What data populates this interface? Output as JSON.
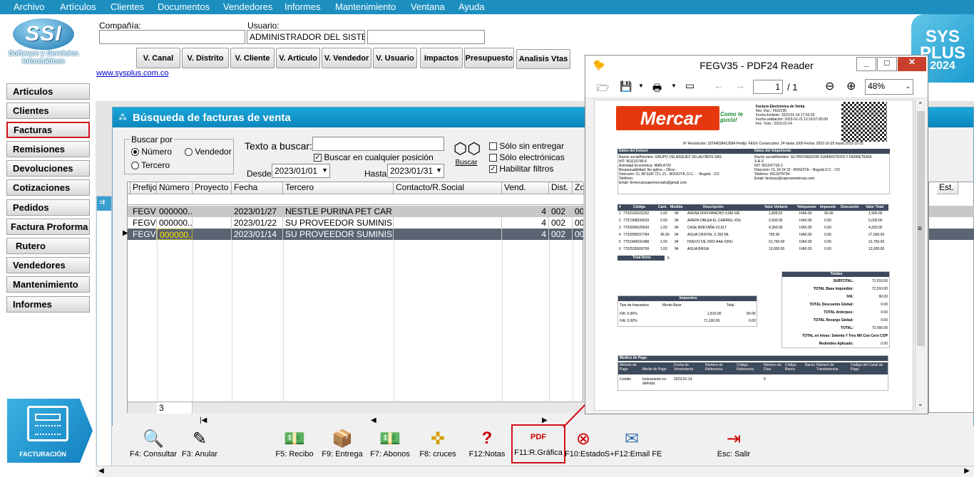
{
  "menu": [
    "Archivo",
    "Artículos",
    "Clientes",
    "Documentos",
    "Vendedores",
    "Informes",
    "Mantenimiento",
    "Ventana",
    "Ayuda"
  ],
  "logo": {
    "text": "SSI",
    "sub1": "Software y Servicios",
    "sub2": "Informáticos",
    "url": "www.sysplus.com.co"
  },
  "syslogo": {
    "line1": "SYS",
    "line2": "PLUS",
    "line3": "2024"
  },
  "company": {
    "label": "Compañía:",
    "value": ""
  },
  "user": {
    "label": "Usuario:",
    "value": "ADMINISTRADOR DEL SISTEM.",
    "extra": ""
  },
  "vbuttons": [
    "V. Canal",
    "V. Distrito",
    "V. Cliente",
    "V. Articulo",
    "V. Vendedor",
    "V. Usuario",
    "Impactos",
    "Presupuesto",
    "Analisis Vtas"
  ],
  "nav": [
    "Articulos",
    "Clientes",
    "Facturas",
    "Remisiones",
    "Devoluciones",
    "Cotizaciones",
    "Pedidos",
    "Factura Proforma",
    "Rutero",
    "Vendedores",
    "Mantenimiento",
    "Informes"
  ],
  "facturacion_label": "FACTURACIÓN",
  "search": {
    "title": "Búsqueda de facturas de venta",
    "buscar_por": "Buscar por",
    "opt_numero": "Número",
    "opt_vendedor": "Vendedor",
    "opt_tercero": "Tercero",
    "texto_label": "Texto a buscar:",
    "texto_value": "",
    "cualquier": "Buscar en cualquier posición",
    "desde_label": "Desde:",
    "desde_value": "2023/01/01",
    "hasta_label": "Hasta:",
    "hasta_value": "2023/01/31",
    "buscar_btn": "Buscar",
    "solo_entregar": "Sólo sin entregar",
    "solo_electronicas": "Sólo electrónicas",
    "habilitar": "Habilitar filtros"
  },
  "grid": {
    "headers": [
      "Prefijo",
      "Número",
      "Proyecto",
      "Fecha",
      "Tercero",
      "Contacto/R.Social",
      "Vend.",
      "Dist.",
      "Zo"
    ],
    "rows": [
      [
        "FEGV",
        "000000...",
        "",
        "2023/01/27",
        "NESTLE PURINA PET CAR...",
        "",
        "4",
        "002",
        "00"
      ],
      [
        "FEGV",
        "000000...",
        "",
        "2023/01/22",
        "SU PROVEEDOR SUMINIS...",
        "",
        "4",
        "002",
        "00"
      ],
      [
        "FEGV",
        "000000...",
        "",
        "2023/01/14",
        "SU PROVEEDOR SUMINIS...",
        "",
        "4",
        "002",
        "00"
      ]
    ],
    "count": "3",
    "est_header": "Est."
  },
  "toolbar": [
    "F4: Consultar",
    "F3: Anular",
    "F5: Recibo",
    "F9: Entrega",
    "F7: Abonos",
    "F8: cruces",
    "F12:Notas",
    "F11:R.Gráfica",
    "F10:Estado",
    "S+F12:Email FE",
    "Esc: Salir"
  ],
  "pdf": {
    "title": "FEGV35 - PDF24 Reader",
    "page": "1",
    "pages": "/ 1",
    "zoom": "48%",
    "brand": "Mercar",
    "tagline": "Como te gusta!",
    "header_lines": [
      "Factura Electrónica de Venta",
      "Nro. Doc.: FEGV35",
      "Fecha Emisión: 2023-01-14 17:03:29",
      "Fecha validación: 2023-01-21 12:16:57-05:00",
      "Fec. Vcto.: 2023-01-14"
    ],
    "resolucion": "Nº Resolución: 18764038412684  Prefijo: FEGV  Consecutivo: 24 hasta 1000  Fecha: 2022-10-25 hasta 2023-10-25",
    "emisor_title": "Datos del Emisor",
    "emisor": [
      "Razón social/Nombre: GRUPO VELASQUEZ VILLALOBOS SAS",
      "NIT: 901116745-6",
      "Actividad Económica: 4849;4729",
      "Responsabilidad: No aplica – Otros -",
      "Dirección: CL 38 SUR 72 L 21 - BOGOTÁ, D.C. - - Bogotá - CO",
      "Teléfono:",
      "Email: fernercarsupermercado@gmail.com"
    ],
    "adquiriente_title": "Datos del Adquiriente",
    "adquiriente": [
      "Razón social/Nombre: SU PROVEEDOR SUMINISTROS Y FERRETERIA",
      "S.A.S",
      "NIT: 901247732-2",
      "Dirección: CL 24 24 32 - BOGOTÁ – Bogotá D.C - CO",
      "Teléfono: 6013379794",
      "Email: facturas@suproveedorsas.com"
    ],
    "items_headers": [
      "#",
      "Código",
      "Cant.",
      "Medida",
      "Descripción",
      "Valor Unitario",
      "%Impuesto",
      "Impuesto",
      "Descuento",
      "Valor Total"
    ],
    "items": [
      [
        "1",
        "7702193101252",
        "1.00",
        "94",
        "AVENA DON PANCHO X180 GR",
        "1,809.52",
        "IVA5.00",
        "90.00",
        "",
        "1,900.00"
      ],
      [
        "2",
        "7707268530029",
        "2.00",
        "94",
        "AREPA OBLEA EL CARRIEL X5U",
        "2,500.00",
        "IVA0.00",
        "0.00",
        "",
        "5,000.00"
      ],
      [
        "3",
        "7702090029543",
        "1.00",
        "94",
        "CASE BRETAÑA X0.5LT",
        "4,350.00",
        "IVA0.00",
        "0.00",
        "",
        "4,350.00"
      ],
      [
        "4",
        "7702090037784",
        "36.00",
        "94",
        "AGUA CRISTAL X 250 ML",
        "750.00",
        "IVA0.00",
        "0.00",
        "",
        "27,000.00"
      ],
      [
        "5",
        "7702349031488",
        "1.00",
        "94",
        "HUEVO DE ORO AAA X30U",
        "21,750.00",
        "IVA0.00",
        "0.00",
        "",
        "21,750.00"
      ],
      [
        "6",
        "7702535009758",
        "1.00",
        "94",
        "AGUA BRISA",
        "13,000.00",
        "IVA0.00",
        "0.00",
        "",
        "13,000.00"
      ]
    ],
    "total_items_label": "Total Items",
    "total_items": "6",
    "totales_title": "Totales",
    "totales": [
      [
        "SUBTOTAL:",
        "72,910.00"
      ],
      [
        "TOTAL Base Imponible:",
        "72,910.00"
      ],
      [
        "IVA:",
        "90.00"
      ],
      [
        "TOTAL Descuento Global:",
        "0.00"
      ],
      [
        "TOTAL Anticipos:",
        "0.00"
      ],
      [
        "TOTAL Recargo Global:",
        "0.00"
      ],
      [
        "TOTAL:",
        "73,000.00"
      ],
      [
        "TOTAL en letras: Setenta Y Tres Mil Con Cero COP",
        ""
      ],
      [
        "Redondeo Aplicado:",
        "0.00"
      ]
    ],
    "impuestos_title": "Impuestos",
    "impuestos_headers": [
      "Tipo de Impuestos",
      "Monto Base",
      "Total"
    ],
    "impuestos": [
      [
        "IVA: 5.00%",
        "1,810.00",
        "90.00"
      ],
      [
        "IVA: 0.00%",
        "71,100.00",
        "0.00"
      ]
    ],
    "pago_title": "Medios de Pago",
    "pago_headers": [
      "Método de Pago",
      "Medio de Pago",
      "Fecha de Vencimiento",
      "Número de Referencia",
      "Código Referencia",
      "Número de Días",
      "Código Banco",
      "Banco",
      "Número de Transferencia",
      "Código del Canal de Pago"
    ],
    "pago_row": [
      "Crédito",
      "Instrumento no definido",
      "2023-01-14",
      "",
      "",
      "0",
      "",
      "",
      "",
      ""
    ]
  }
}
